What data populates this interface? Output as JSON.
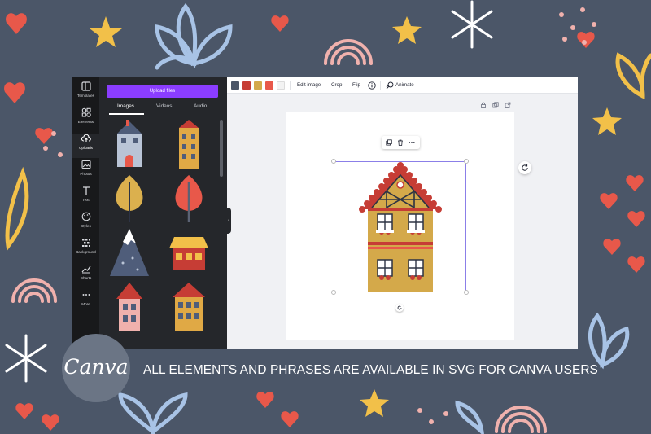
{
  "colors": {
    "background": "#4b5668",
    "accent_purple": "#8b3dff",
    "panel_dark": "#25272b",
    "rail_dark": "#18191b",
    "heart_red": "#e8584a",
    "star_yellow": "#f2c049",
    "leaf_blue": "#a8c3e6",
    "rainbow_pink": "#f0b1ad"
  },
  "sidebar": {
    "items": [
      {
        "label": "Templates",
        "icon": "templates-icon"
      },
      {
        "label": "Elements",
        "icon": "elements-icon"
      },
      {
        "label": "Uploads",
        "icon": "upload-cloud-icon"
      },
      {
        "label": "Photos",
        "icon": "photo-icon"
      },
      {
        "label": "Text",
        "icon": "text-icon"
      },
      {
        "label": "Styles",
        "icon": "palette-icon"
      },
      {
        "label": "Background",
        "icon": "background-icon"
      },
      {
        "label": "Charts",
        "icon": "chart-icon"
      },
      {
        "label": "More",
        "icon": "more-icon"
      }
    ]
  },
  "panel": {
    "upload_button": "Upload files",
    "tabs": [
      "Images",
      "Videos",
      "Audio"
    ]
  },
  "toolbar": {
    "swatches": [
      "#4b5668",
      "#c63d35",
      "#d4a94a",
      "#e8584a",
      "#f3f3f3"
    ],
    "edit_image": "Edit image",
    "crop": "Crop",
    "flip": "Flip",
    "info_icon": "info-icon",
    "animate": "Animate"
  },
  "branding": {
    "logo": "Canva",
    "tagline": "ALL ELEMENTS AND PHRASES ARE AVAILABLE IN SVG FOR CANVA USERS"
  }
}
